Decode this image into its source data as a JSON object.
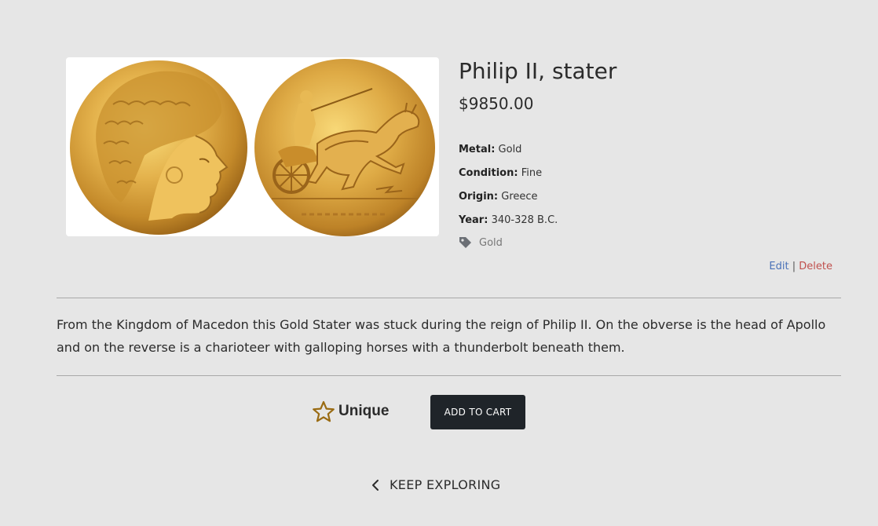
{
  "product": {
    "title": "Philip II, stater",
    "price": "$9850.00",
    "details": [
      {
        "label": "Metal:",
        "value": "Gold"
      },
      {
        "label": "Condition:",
        "value": "Fine"
      },
      {
        "label": "Origin:",
        "value": "Greece"
      },
      {
        "label": "Year:",
        "value": "340-328 B.C."
      }
    ],
    "tag": "Gold",
    "tag_icon": "tag-icon",
    "image_icons": [
      "coin-obverse-apollo-head",
      "coin-reverse-chariot"
    ],
    "description": "From the Kingdom of Macedon this Gold Stater was stuck during the reign of Philip II. On the obverse is the head of Apollo and on the reverse is a charioteer with galloping horses with a thunderbolt beneath them."
  },
  "admin": {
    "edit_label": "Edit",
    "separator": "|",
    "delete_label": "Delete"
  },
  "actions": {
    "unique_label": "Unique",
    "unique_icon": "star-outline-icon",
    "add_to_cart_label": "ADD TO CART"
  },
  "nav": {
    "keep_exploring_label": "KEEP EXPLORING",
    "keep_exploring_icon": "chevron-left-icon"
  },
  "colors": {
    "background": "#e6e6e6",
    "button_dark": "#1f2429",
    "edit_link": "#4a72b8",
    "delete_link": "#c0504d",
    "star_outline": "#9a6b12",
    "coin_gold": "#d9a43a"
  }
}
